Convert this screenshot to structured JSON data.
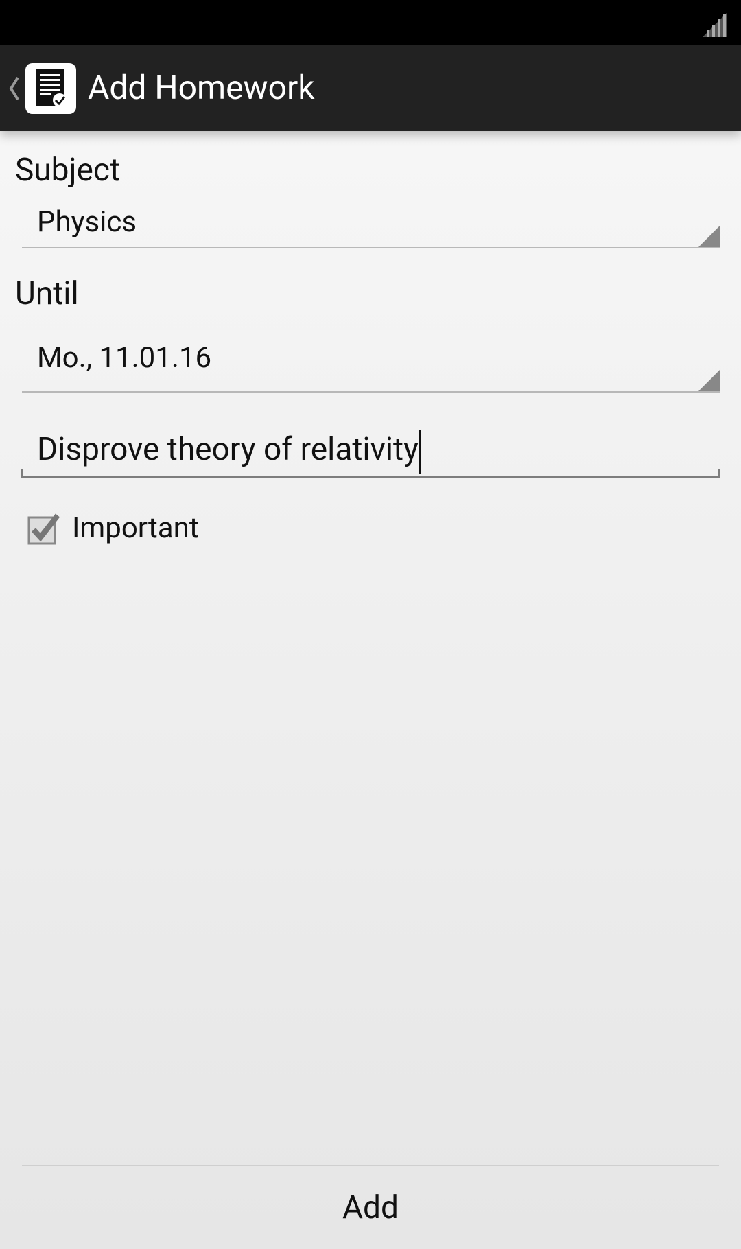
{
  "status_bar": {
    "signal_icon": "signal-strength-icon"
  },
  "action_bar": {
    "back_icon": "chevron-left-icon",
    "app_icon": "homework-document-icon",
    "title": "Add Homework"
  },
  "form": {
    "subject": {
      "label": "Subject",
      "value": "Physics"
    },
    "until": {
      "label": "Until",
      "value": "Mo., 11.01.16"
    },
    "description": {
      "value": "Disprove theory of relativity"
    },
    "important": {
      "label": "Important",
      "checked": true
    }
  },
  "footer": {
    "add_label": "Add"
  }
}
